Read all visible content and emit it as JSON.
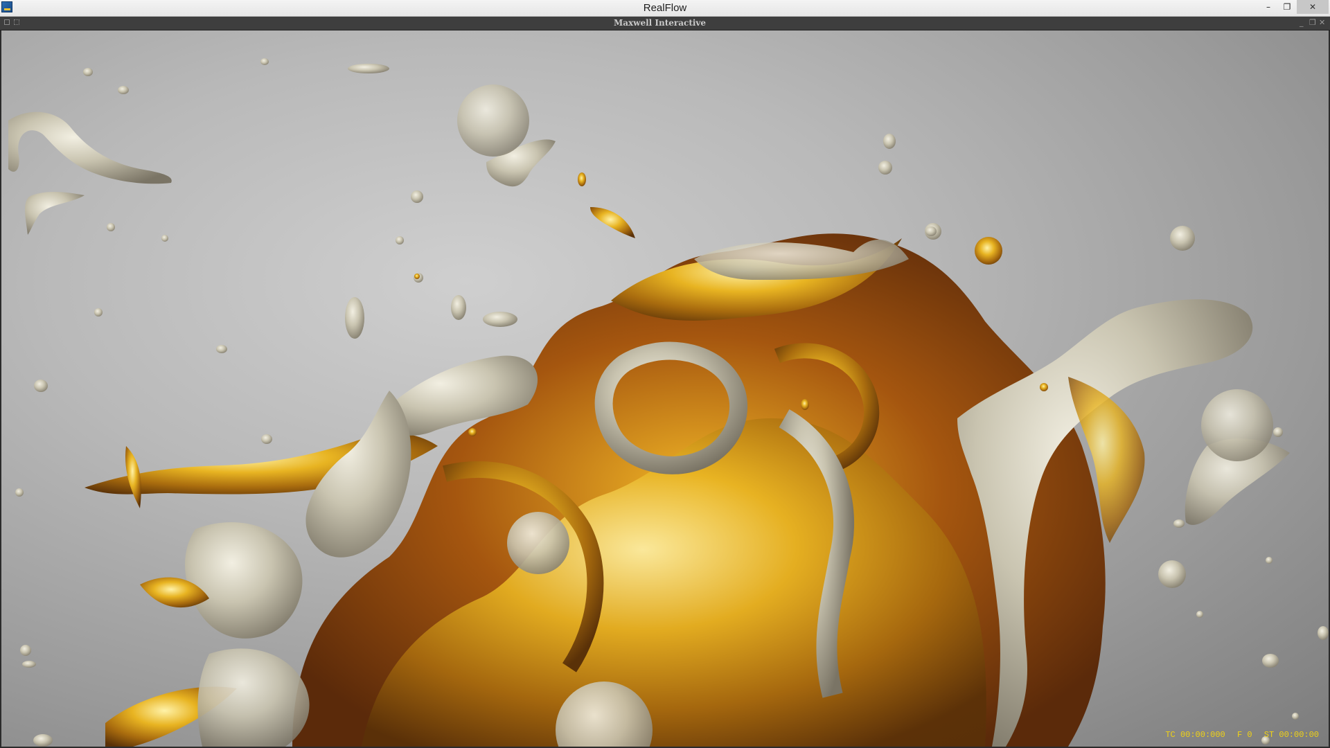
{
  "window": {
    "title": "RealFlow",
    "controls": {
      "minimize": "–",
      "restore": "❐",
      "close": "✕"
    }
  },
  "panel": {
    "title": "Maxwell Interactive",
    "controls": {
      "minimize": "_",
      "float": "❐",
      "close": "✕"
    }
  },
  "viewport": {
    "content": "render-view",
    "status": {
      "tc": "TC 00:00:000",
      "frame": "F 0",
      "st": "ST 00:00:00"
    }
  },
  "colors": {
    "gold": "#d9a520",
    "silver": "#c8c4b0",
    "status_text": "#f1d214"
  }
}
